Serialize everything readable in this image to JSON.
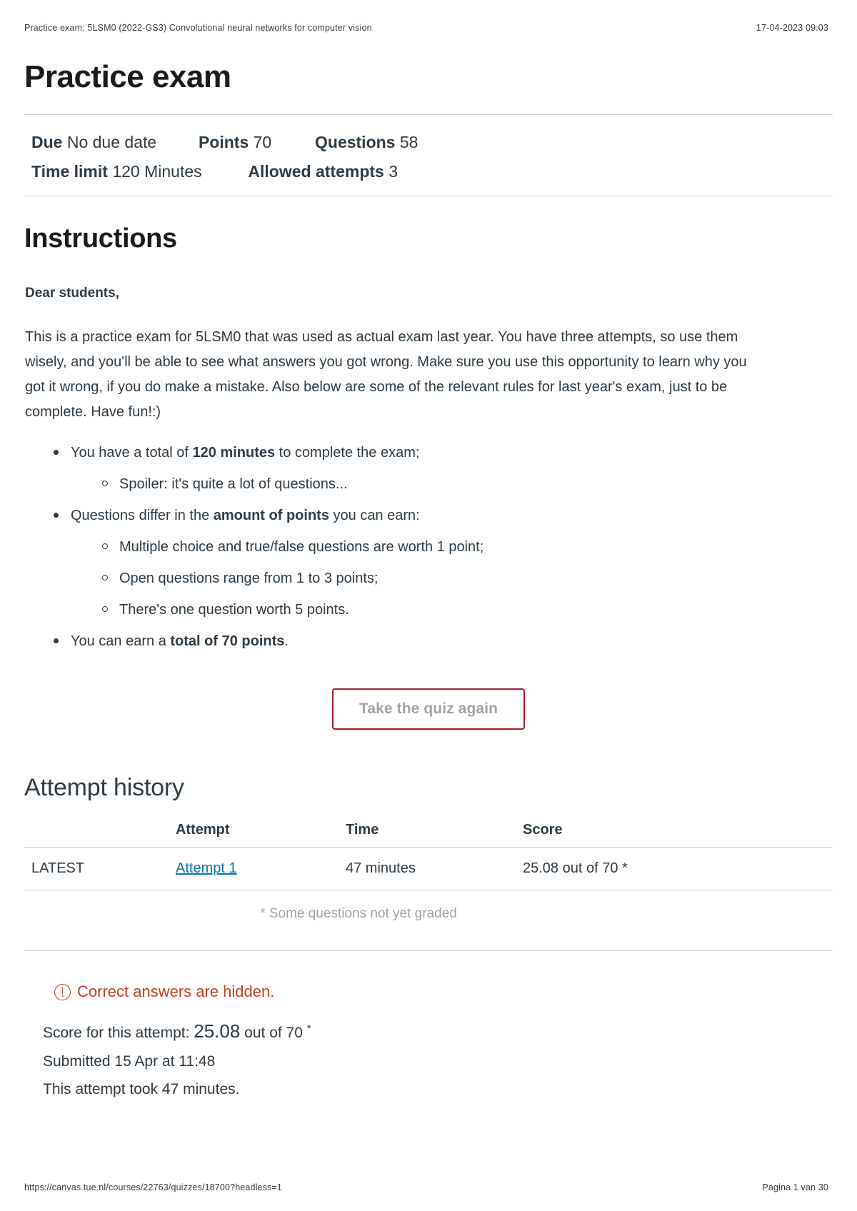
{
  "print_header": {
    "left": "Practice exam: 5LSM0 (2022-GS3) Convolutional neural networks for computer vision",
    "right": "17-04-2023 09:03"
  },
  "page_title": "Practice exam",
  "quiz_meta": {
    "due_label": "Due",
    "due_value": "No due date",
    "points_label": "Points",
    "points_value": "70",
    "questions_label": "Questions",
    "questions_value": "58",
    "time_limit_label": "Time limit",
    "time_limit_value": "120 Minutes",
    "allowed_attempts_label": "Allowed attempts",
    "allowed_attempts_value": "3"
  },
  "instructions": {
    "heading": "Instructions",
    "salutation": "Dear students,",
    "paragraph": "This is a practice exam for 5LSM0 that was used as actual exam last year. You have three attempts, so use them wisely, and you'll be able to see what answers you got wrong. Make sure you use this opportunity to learn why you got it wrong, if you do make a mistake. Also below are some of the relevant rules for last year's exam, just to be complete. Have fun!:)",
    "bullets": [
      {
        "pre": "You have a total of ",
        "bold": "120 minutes",
        "post": " to complete the exam;",
        "sub": [
          {
            "pre": "Spoiler: it's quite a lot of questions...",
            "bold": "",
            "post": ""
          }
        ]
      },
      {
        "pre": "Questions differ in the ",
        "bold": "amount of points",
        "post": " you can earn:",
        "sub": [
          {
            "pre": "Multiple choice and true/false questions are worth 1 point;",
            "bold": "",
            "post": ""
          },
          {
            "pre": "Open questions range from 1 to 3 points;",
            "bold": "",
            "post": ""
          },
          {
            "pre": "There's one question worth 5 points.",
            "bold": "",
            "post": ""
          }
        ]
      },
      {
        "pre": "You can earn a ",
        "bold": "total of 70 points",
        "post": ".",
        "sub": []
      }
    ]
  },
  "take_quiz_button": "Take the quiz again",
  "attempt_history": {
    "heading": "Attempt history",
    "columns": [
      "",
      "Attempt",
      "Time",
      "Score"
    ],
    "rows": [
      {
        "label": "LATEST",
        "attempt": "Attempt 1",
        "time": "47 minutes",
        "score": "25.08 out of 70 *"
      }
    ],
    "footnote": "* Some questions not yet graded"
  },
  "alert": {
    "icon": "warning-circle-icon",
    "text": "Correct answers are hidden.",
    "color": "#c74122"
  },
  "score_summary": {
    "score_label": "Score for this attempt:",
    "score_value": "25.08",
    "score_out_of": " out of 70",
    "score_asterisk": "*",
    "submitted": "Submitted 15 Apr at 11:48",
    "duration": "This attempt took 47 minutes."
  },
  "print_footer": {
    "left": "https://canvas.tue.nl/courses/22763/quizzes/18700?headless=1",
    "right": "Pagina 1 van 30"
  }
}
